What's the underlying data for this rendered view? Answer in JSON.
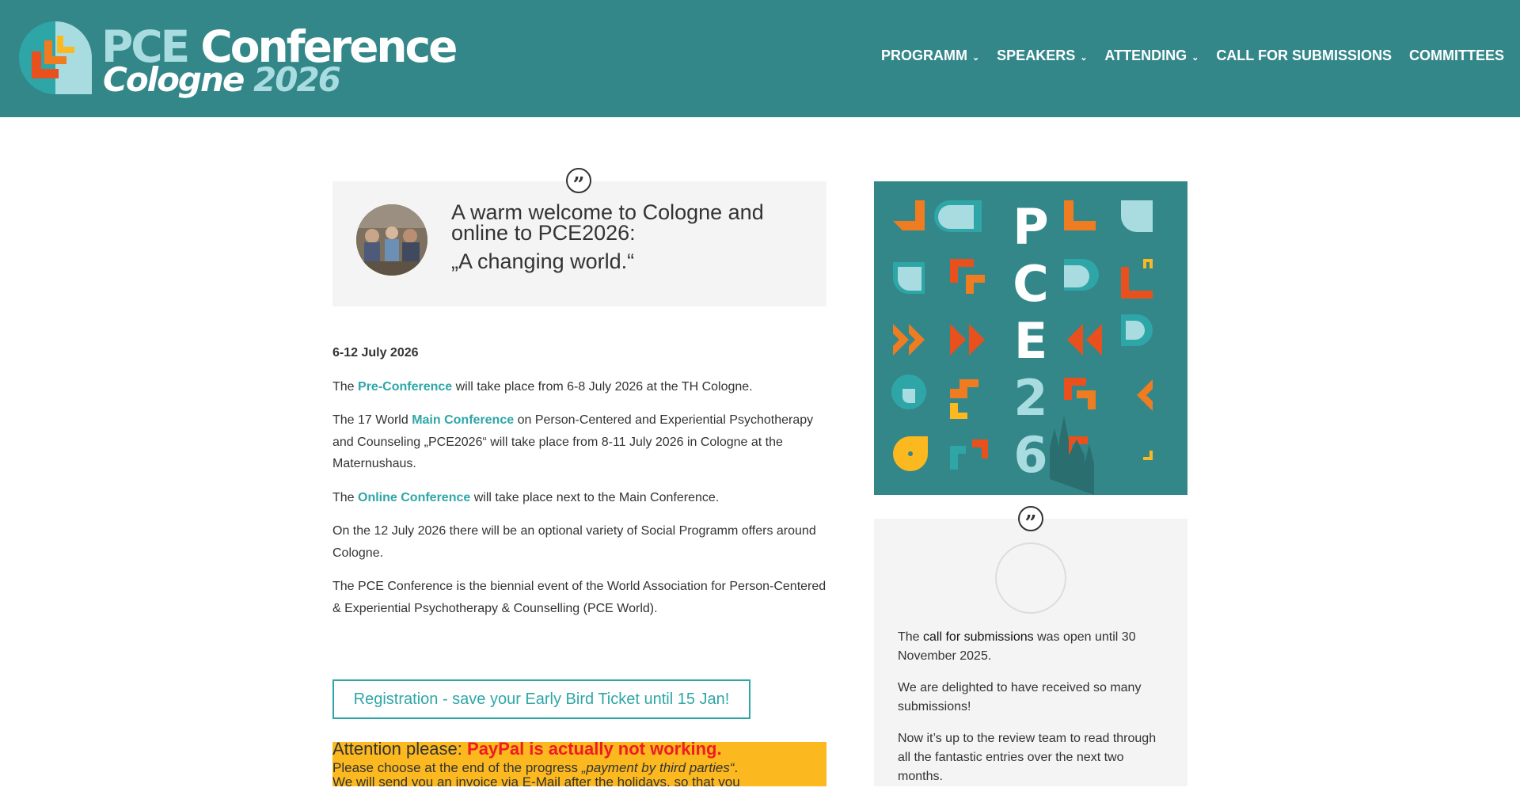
{
  "header": {
    "logo": {
      "title_pce": "PCE",
      "title_conference": "Conference",
      "title_city": "Cologne",
      "title_year": "2026"
    },
    "nav": [
      {
        "label": "PROGRAMM",
        "has_dropdown": true
      },
      {
        "label": "SPEAKERS",
        "has_dropdown": true
      },
      {
        "label": "ATTENDING",
        "has_dropdown": true
      },
      {
        "label": "CALL FOR SUBMISSIONS",
        "has_dropdown": false
      },
      {
        "label": "COMMITTEES",
        "has_dropdown": false
      }
    ]
  },
  "main": {
    "welcome_quote": {
      "line1": "A warm welcome to Cologne and online to PCE2026:",
      "line2": "„A changing world.“"
    },
    "date": "6-12 July 2026",
    "p1": {
      "before": "The ",
      "link": "Pre-Conference",
      "after": " will take place from 6-8 July 2026 at the TH Cologne."
    },
    "p2": {
      "before": "The 17 World ",
      "link": "Main Conference",
      "after": " on Person-Centered and Experiential Psychotherapy and Counseling „PCE2026“ will take place from 8-11 July 2026 in Cologne at the Maternushaus."
    },
    "p3": {
      "before": "The ",
      "link": "Online Conference",
      "after": " will take place next to the Main Conference."
    },
    "p4": "On the 12 July 2026 there will be an optional variety of Social Programm offers around Cologne.",
    "p5": "The PCE Conference is the biennial event of the World Association for Person-Centered & Experiential Psychotherapy & Counselling (PCE World).",
    "registration_button": "Registration - save your Early Bird Ticket until 15 Jan!",
    "attention": {
      "prefix": "Attention please: ",
      "highlight": "PayPal is actually not working.",
      "line2_before": "Please choose at the end of the progress ",
      "line2_em": "„payment by third parties“",
      "line2_after": ".",
      "line3": "We will send you an invoice via E-Mail after the holidays, so that you"
    }
  },
  "sidebar": {
    "poster_letters": [
      "P",
      "C",
      "E",
      "2",
      "6"
    ],
    "news": {
      "p1_before": "The ",
      "p1_link": "call for submissions",
      "p1_after": " was open until 30 November 2025.",
      "p2": "We are delighted to have received so many submissions!",
      "p3": "Now it’s up to the review team to read through all the fantastic entries over the next two months."
    }
  },
  "colors": {
    "header_bg": "#348789",
    "accent_teal": "#2ea6a8",
    "light_teal": "#a9dce0",
    "orange": "#f07c22",
    "red_orange": "#e8501e",
    "yellow": "#fbb81f",
    "alert_red": "#ee1c24",
    "panel_bg": "#f4f4f4"
  }
}
